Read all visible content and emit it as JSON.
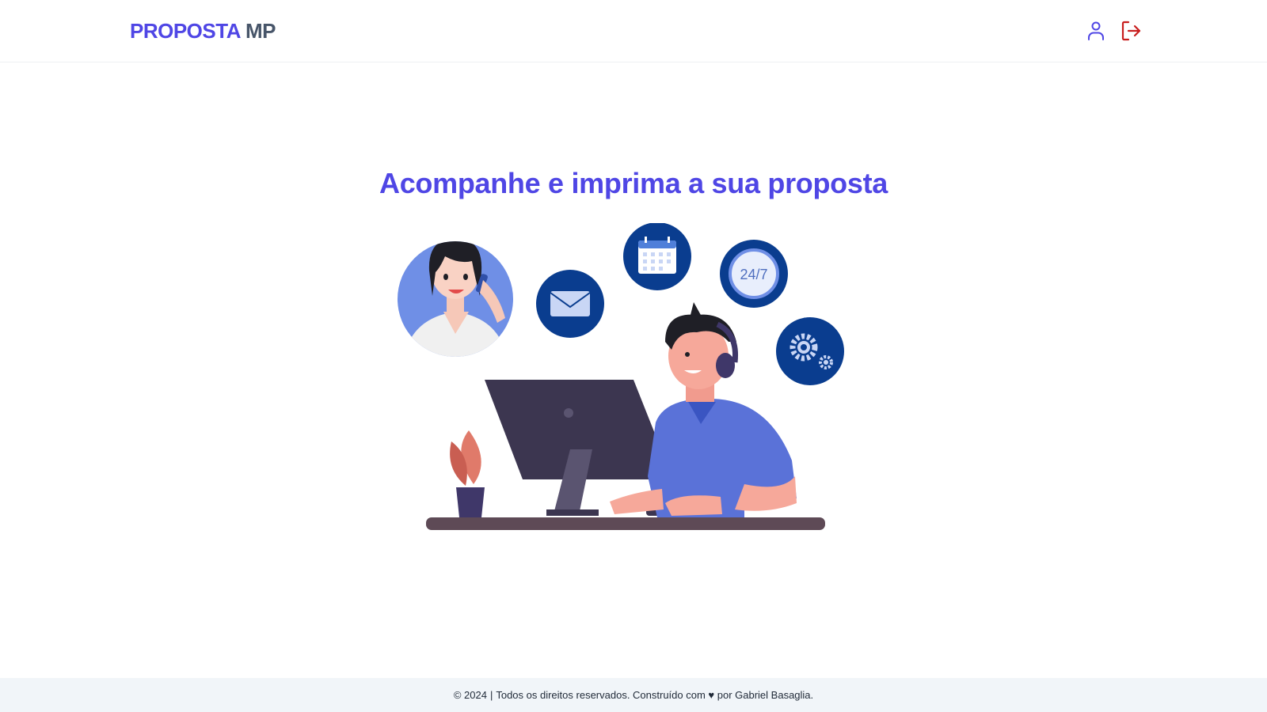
{
  "header": {
    "brand_part1": "PROPOSTA",
    "brand_part2": "MP",
    "actions": [
      {
        "icon": "user-icon"
      },
      {
        "icon": "logout-icon"
      }
    ]
  },
  "main": {
    "headline": "Acompanhe e imprima a sua proposta",
    "illustration": {
      "clock_label": "24/7"
    }
  },
  "footer": {
    "copyright": "© 2024",
    "separator": "|",
    "text": "Todos os direitos reservados. Construído com ♥ por Gabriel Basaglia."
  },
  "colors": {
    "brand": "#4f46e5",
    "brand_secondary": "#475569",
    "logout": "#c81e1e",
    "footer_bg": "#f1f5f9",
    "icon_circle": "#0a3d8f"
  }
}
